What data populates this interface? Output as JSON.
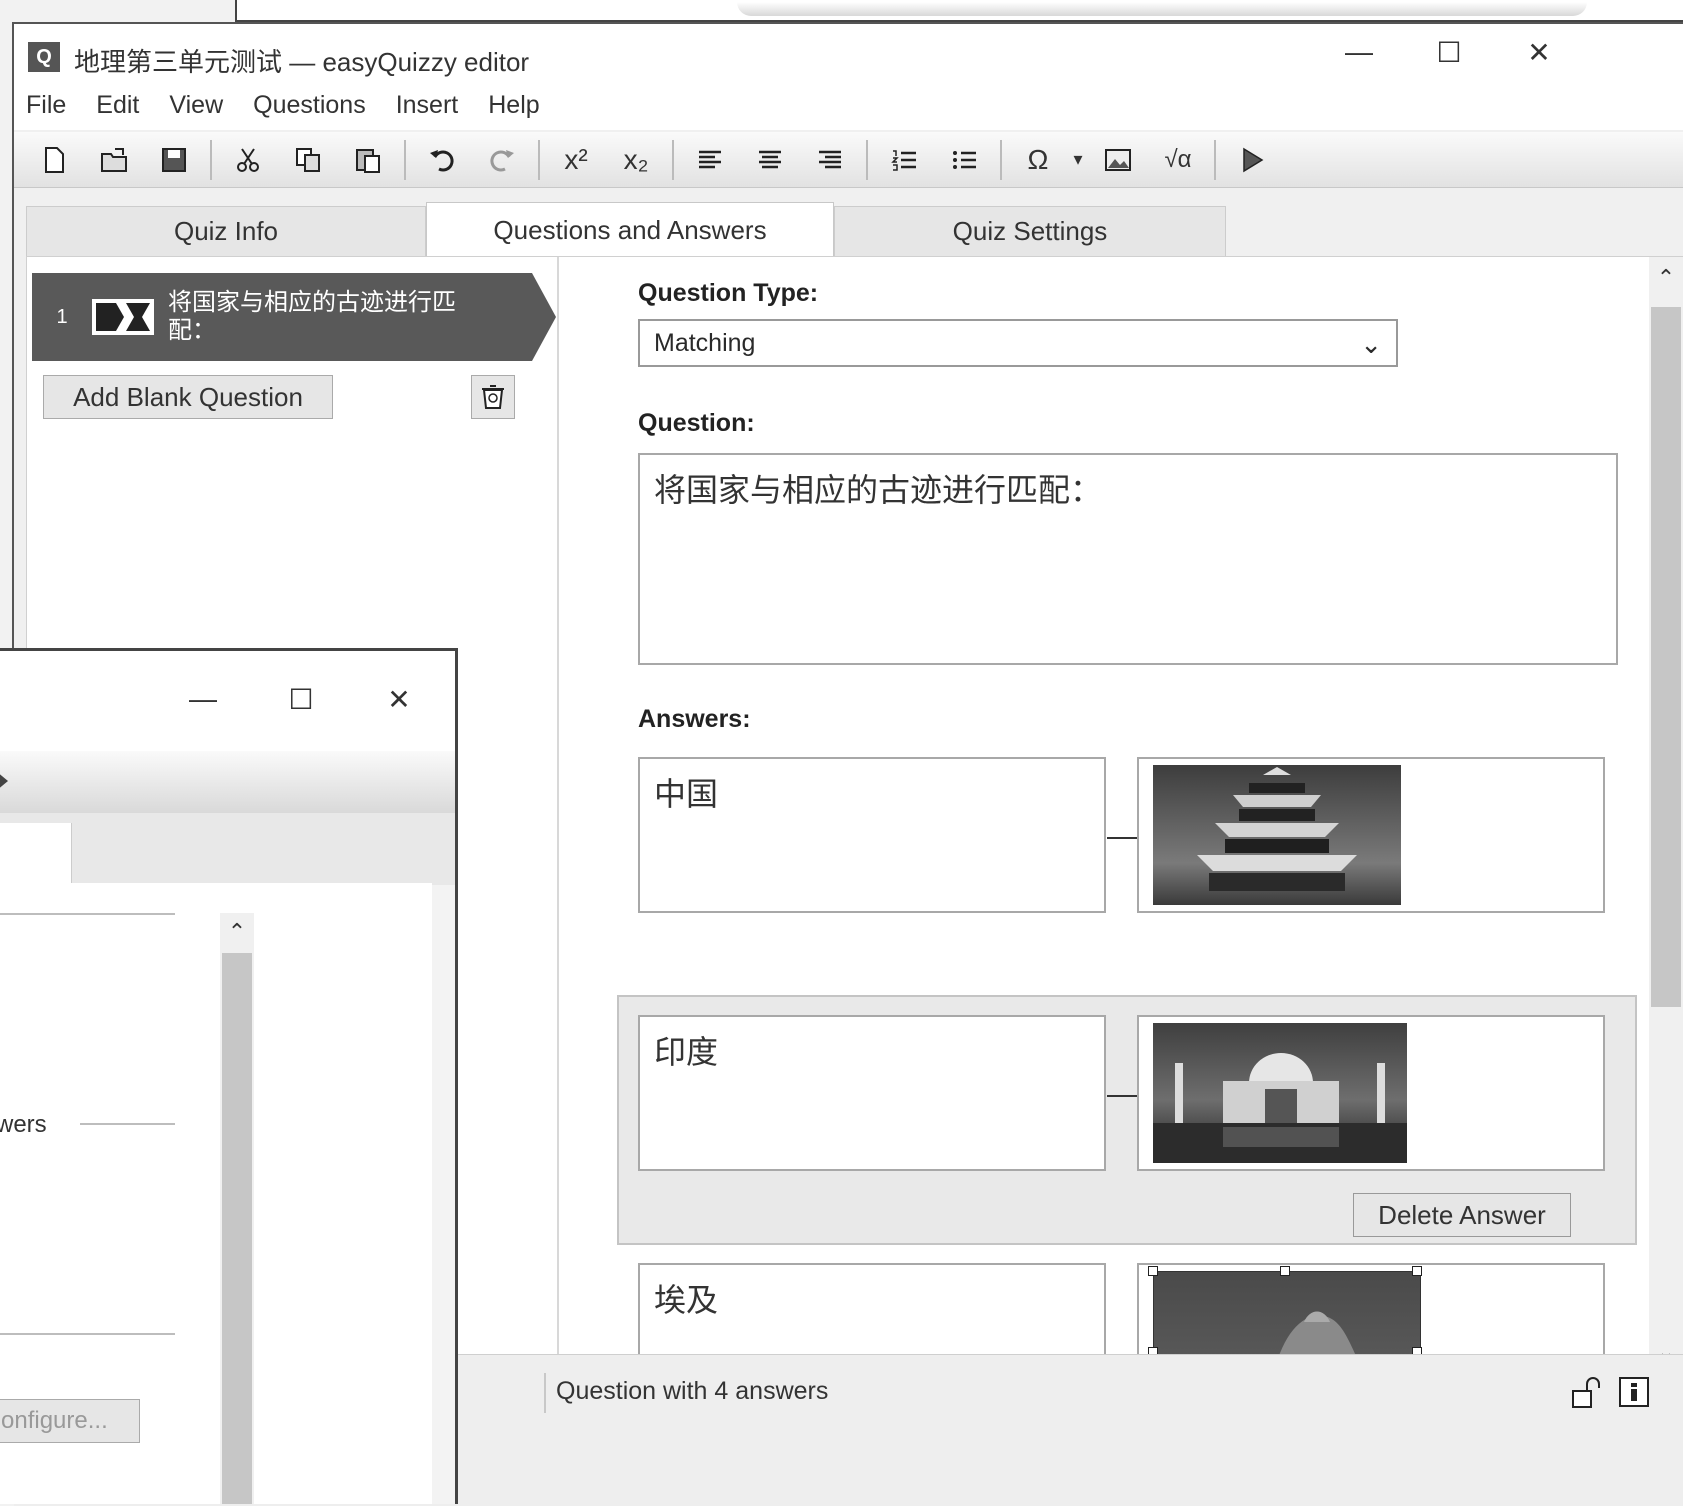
{
  "window": {
    "app_icon": "Q",
    "title": "地理第三单元测试 — easyQuizzy editor",
    "controls": {
      "minimize": "—",
      "maximize": "☐",
      "close": "✕"
    }
  },
  "menu": [
    "File",
    "Edit",
    "View",
    "Questions",
    "Insert",
    "Help"
  ],
  "toolbar": {
    "icons": [
      "new-file-icon",
      "open-folder-icon",
      "save-icon",
      "cut-icon",
      "copy-icon",
      "paste-icon",
      "undo-icon",
      "redo-icon",
      "superscript-icon",
      "subscript-icon",
      "align-left-icon",
      "align-center-icon",
      "align-right-icon",
      "numbered-list-icon",
      "bullet-list-icon",
      "omega-symbol-icon",
      "insert-image-icon",
      "formula-icon",
      "play-icon"
    ],
    "omega_glyph": "Ω",
    "superscript_glyph": "x²",
    "subscript_glyph": "x₂",
    "formula_glyph": "√α"
  },
  "tabs": [
    {
      "label": "Quiz Info",
      "active": false
    },
    {
      "label": "Questions and Answers",
      "active": true
    },
    {
      "label": "Quiz Settings",
      "active": false
    }
  ],
  "question_list": {
    "items": [
      {
        "number": "1",
        "type_icon": "matching-icon",
        "title": "将国家与相应的古迹进行匹配："
      }
    ],
    "add_blank_label": "Add Blank Question",
    "delete_icon": "trash-icon"
  },
  "editor": {
    "question_type_label": "Question Type:",
    "question_type_value": "Matching",
    "question_label": "Question:",
    "question_text": "将国家与相应的古迹进行匹配：",
    "answers_label": "Answers:",
    "answers": [
      {
        "left": "中国",
        "image": "temple-of-heaven-image",
        "selected": false
      },
      {
        "left": "印度",
        "image": "taj-mahal-image",
        "selected": true
      },
      {
        "left": "埃及",
        "image": "sphinx-image",
        "selected": false
      }
    ],
    "delete_answer_label": "Delete Answer"
  },
  "status": {
    "text": "Question with 4 answers",
    "icons": [
      "unlock-icon",
      "info-icon"
    ]
  },
  "front_window": {
    "controls": {
      "minimize": "—",
      "maximize": "☐",
      "close": "✕"
    },
    "partial_text_wers": "wers",
    "configure_label": "onfigure..."
  }
}
